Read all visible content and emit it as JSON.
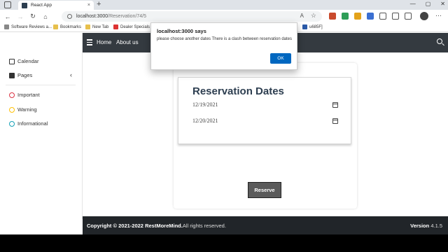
{
  "browser": {
    "tab_title": "React App",
    "tab_close": "×",
    "new_tab": "+",
    "window_controls": [
      "—",
      "▢",
      "✕"
    ],
    "url_host": "localhost:3000",
    "url_path": "/Reservation/74/5",
    "bookmarks": [
      "Software Reviews a...",
      "Bookmarks",
      "New Tab",
      "Dealer Specials",
      "u685F]"
    ]
  },
  "sidebar": {
    "items": [
      {
        "label": "Calendar"
      },
      {
        "label": "Pages"
      },
      {
        "label": "Important",
        "color": "#dc3545"
      },
      {
        "label": "Warning",
        "color": "#ffc107"
      },
      {
        "label": "Informational",
        "color": "#17a2b8"
      }
    ],
    "chevron": "‹"
  },
  "topnav": {
    "home": "Home",
    "about": "About us"
  },
  "reservation": {
    "title": "Reservation Dates",
    "dates": [
      "12/19/2021",
      "12/20/2021"
    ],
    "reserve_label": "Reserve"
  },
  "footer": {
    "copyright_prefix": "Copyright © 2021-2022 ",
    "brand": "RestMoreMind.",
    "rights": "All rights reserved.",
    "version_label": "Version ",
    "version_number": "4.1.5"
  },
  "dialog": {
    "title": "localhost:3000 says",
    "message": "please choose another dates There is a clash between reservation dates",
    "ok_label": "OK"
  },
  "colors": {
    "navbar": "#343a40",
    "footer": "#212529",
    "accent": "#0067c0"
  }
}
